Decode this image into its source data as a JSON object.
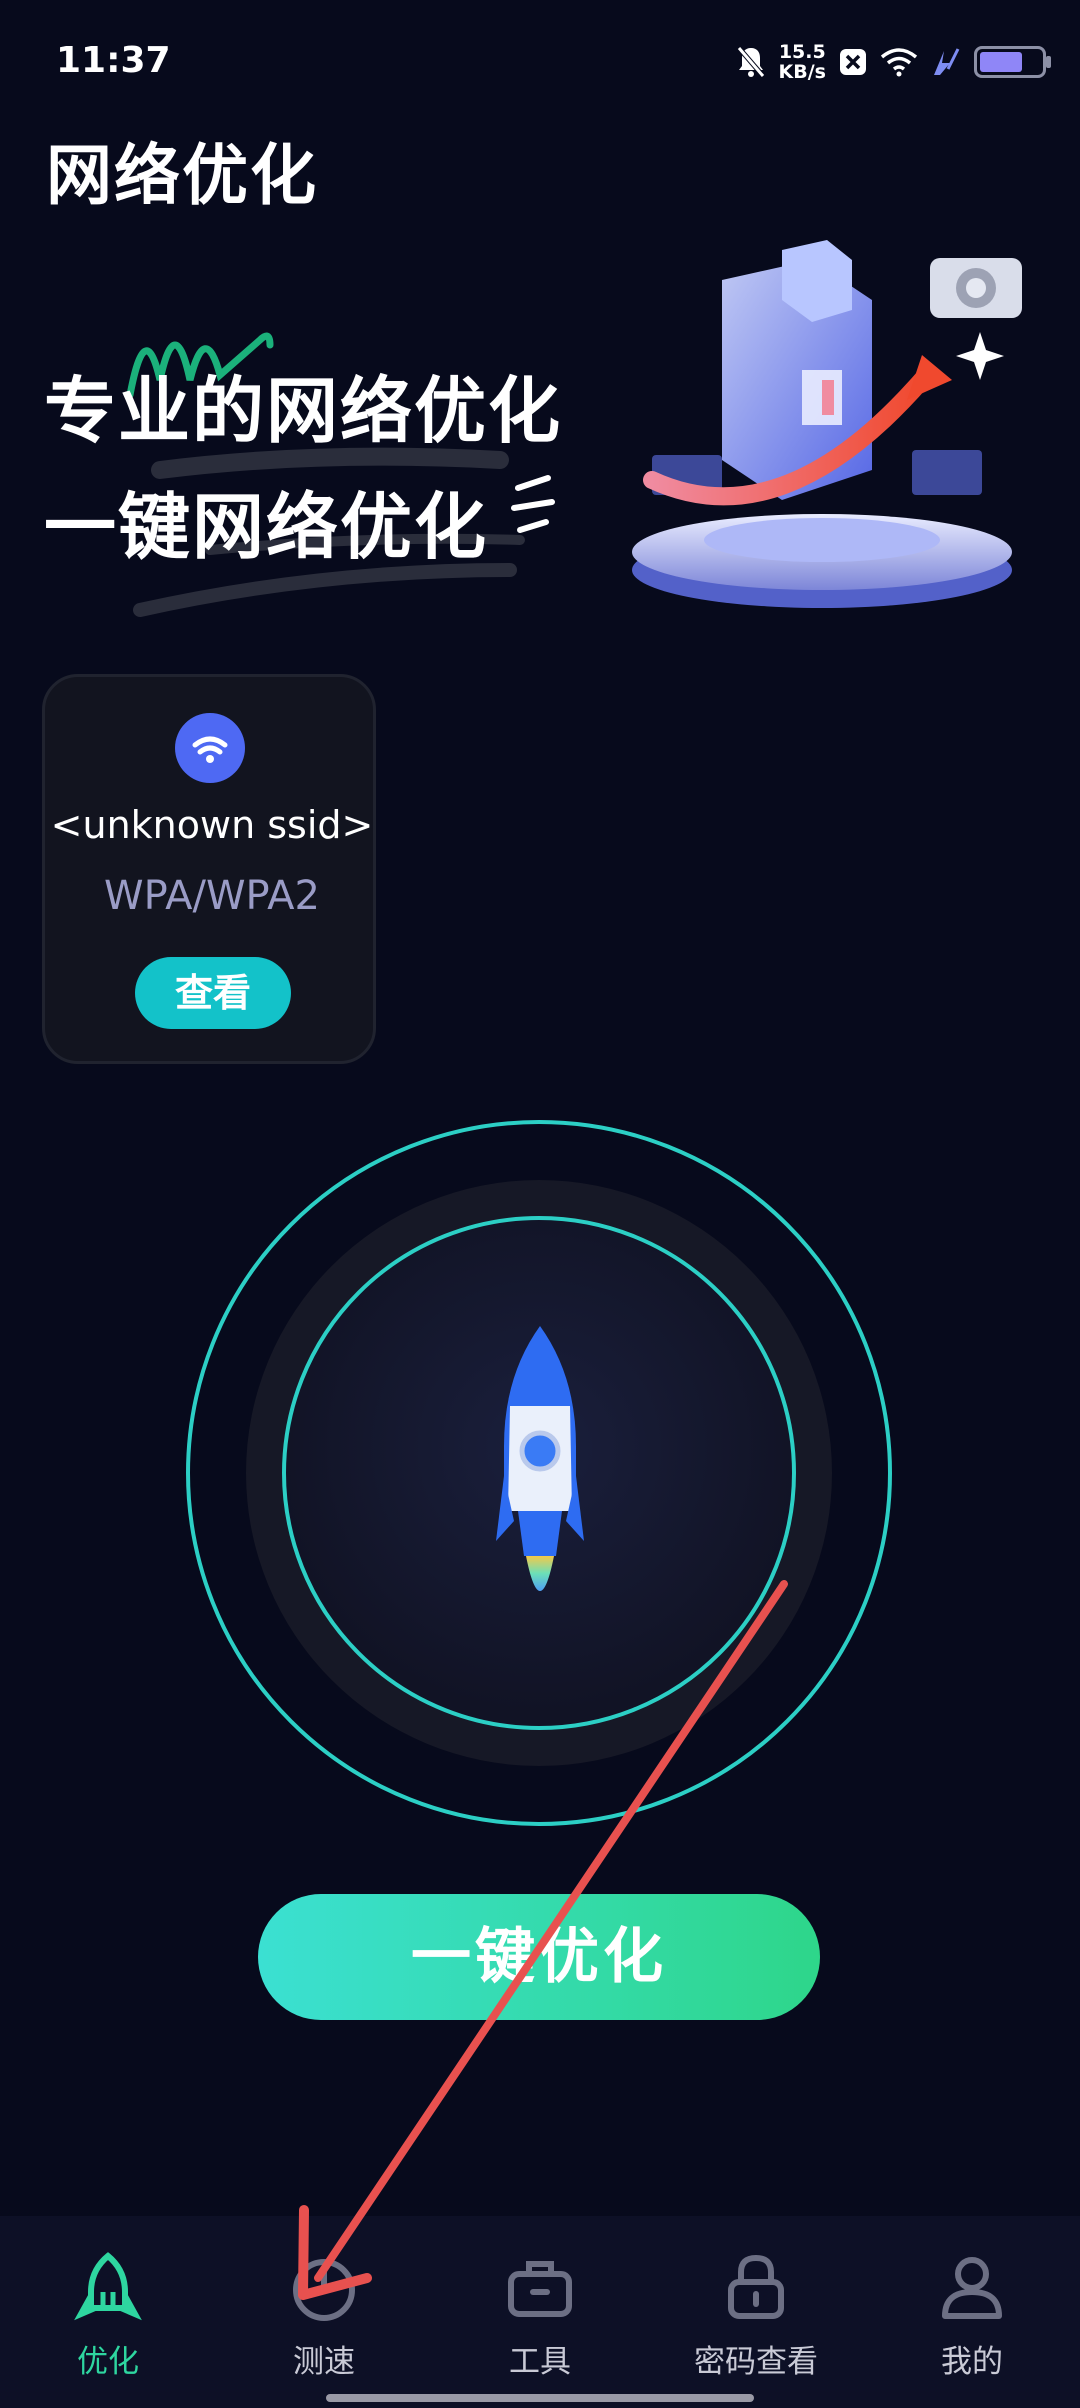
{
  "status_bar": {
    "time": "11:37",
    "net_speed_value": "15.5",
    "net_speed_unit": "KB/s",
    "battery_level": 0.78,
    "icons": [
      "bell-muted-icon",
      "close-badge-icon",
      "wifi-icon",
      "charging-icon",
      "battery-icon"
    ]
  },
  "header": {
    "title": "网络优化"
  },
  "banner": {
    "line1": "专业的网络优化",
    "line2": "一键网络优化"
  },
  "wifi_card": {
    "ssid": "<unknown ssid>",
    "security": "WPA/WPA2",
    "view_label": "查看"
  },
  "optimize": {
    "button_label": "一键优化"
  },
  "nav": {
    "items": [
      {
        "label": "优化",
        "icon": "rocket-icon",
        "active": true
      },
      {
        "label": "测速",
        "icon": "speedometer-icon",
        "active": false
      },
      {
        "label": "工具",
        "icon": "toolbox-icon",
        "active": false
      },
      {
        "label": "密码查看",
        "icon": "lock-icon",
        "active": false
      },
      {
        "label": "我的",
        "icon": "user-icon",
        "active": false
      }
    ]
  },
  "colors": {
    "background": "#070A1C",
    "accent_teal": "#2CCFC5",
    "accent_green": "#2ED68A",
    "wifi_blue": "#4E69F3",
    "annotation_arrow": "#E8514F"
  }
}
